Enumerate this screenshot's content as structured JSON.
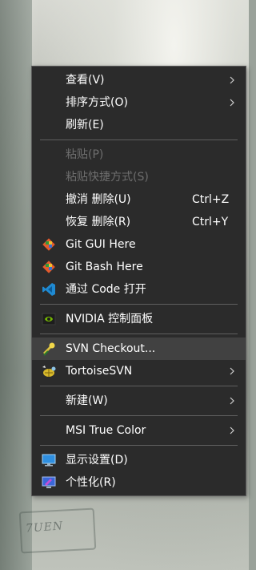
{
  "wallpaper": {
    "caption": "7UEN"
  },
  "menu": {
    "view": {
      "label": "查看(V)"
    },
    "sort": {
      "label": "排序方式(O)"
    },
    "refresh": {
      "label": "刷新(E)"
    },
    "paste": {
      "label": "粘贴(P)"
    },
    "paste_shortcut": {
      "label": "粘贴快捷方式(S)"
    },
    "undo_delete": {
      "label": "撤消 删除(U)",
      "shortcut": "Ctrl+Z"
    },
    "redo_delete": {
      "label": "恢复 删除(R)",
      "shortcut": "Ctrl+Y"
    },
    "git_gui": {
      "label": "Git GUI Here",
      "icon": "git-icon"
    },
    "git_bash": {
      "label": "Git Bash Here",
      "icon": "git-icon"
    },
    "open_code": {
      "label": "通过 Code 打开",
      "icon": "vscode-icon"
    },
    "nvidia": {
      "label": "NVIDIA 控制面板",
      "icon": "nvidia-icon"
    },
    "svn_checkout": {
      "label": "SVN Checkout...",
      "icon": "svn-checkout-icon"
    },
    "tortoise_svn": {
      "label": "TortoiseSVN",
      "icon": "tortoisesvn-icon"
    },
    "new": {
      "label": "新建(W)"
    },
    "msi_true_color": {
      "label": "MSI True Color"
    },
    "display_settings": {
      "label": "显示设置(D)",
      "icon": "display-icon"
    },
    "personalize": {
      "label": "个性化(R)",
      "icon": "personalize-icon"
    }
  },
  "colors": {
    "menu_bg": "#2b2b2b",
    "hover_bg": "#414141",
    "text": "#ffffff",
    "disabled_text": "#6e6e6e",
    "separator": "#5f5f5f"
  }
}
